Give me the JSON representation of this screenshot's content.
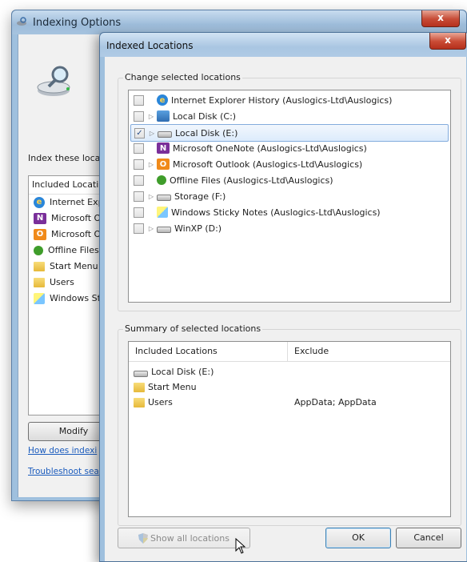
{
  "back_window": {
    "title": "Indexing Options",
    "close_label": "x",
    "index_label": "Index these loca",
    "list_header": "Included Locatio",
    "items": [
      {
        "label": "Internet Exp",
        "icon": "ie-icon"
      },
      {
        "label": "Microsoft On",
        "icon": "onenote-icon"
      },
      {
        "label": "Microsoft Ou",
        "icon": "outlook-icon"
      },
      {
        "label": "Offline Files",
        "icon": "offline-files-icon"
      },
      {
        "label": "Start Menu",
        "icon": "folder-icon"
      },
      {
        "label": "Users",
        "icon": "folder-icon"
      },
      {
        "label": "Windows Sti",
        "icon": "sticky-notes-icon"
      }
    ],
    "modify_label": "Modify",
    "link1": "How does indexi",
    "link2": "Troubleshoot sea"
  },
  "front_window": {
    "title": "Indexed Locations",
    "close_label": "x",
    "change_group_label": "Change selected locations",
    "locations": [
      {
        "label": "Internet Explorer History (Auslogics-Ltd\\Auslogics)",
        "checked": false,
        "expandable": false,
        "icon": "ie-icon"
      },
      {
        "label": "Local Disk (C:)",
        "checked": false,
        "expandable": true,
        "icon": "windows-disk-icon"
      },
      {
        "label": "Local Disk (E:)",
        "checked": true,
        "expandable": true,
        "icon": "disk-icon",
        "selected": true
      },
      {
        "label": "Microsoft OneNote (Auslogics-Ltd\\Auslogics)",
        "checked": false,
        "expandable": false,
        "icon": "onenote-icon"
      },
      {
        "label": "Microsoft Outlook (Auslogics-Ltd\\Auslogics)",
        "checked": false,
        "expandable": true,
        "icon": "outlook-icon"
      },
      {
        "label": "Offline Files (Auslogics-Ltd\\Auslogics)",
        "checked": false,
        "expandable": false,
        "icon": "offline-files-icon"
      },
      {
        "label": "Storage (F:)",
        "checked": false,
        "expandable": true,
        "icon": "disk-icon"
      },
      {
        "label": "Windows Sticky Notes (Auslogics-Ltd\\Auslogics)",
        "checked": false,
        "expandable": false,
        "icon": "sticky-notes-icon"
      },
      {
        "label": "WinXP (D:)",
        "checked": false,
        "expandable": true,
        "icon": "disk-icon"
      }
    ],
    "check_mark": "✓",
    "expander_glyph": "▷",
    "summary_group_label": "Summary of selected locations",
    "summary_columns": [
      "Included Locations",
      "Exclude"
    ],
    "summary_rows": [
      {
        "location": "Local Disk (E:)",
        "exclude": "",
        "icon": "disk-icon"
      },
      {
        "location": "Start Menu",
        "exclude": "",
        "icon": "folder-icon"
      },
      {
        "location": "Users",
        "exclude": "AppData; AppData",
        "icon": "folder-icon"
      }
    ],
    "show_all_label": "Show all locations",
    "ok_label": "OK",
    "cancel_label": "Cancel"
  }
}
